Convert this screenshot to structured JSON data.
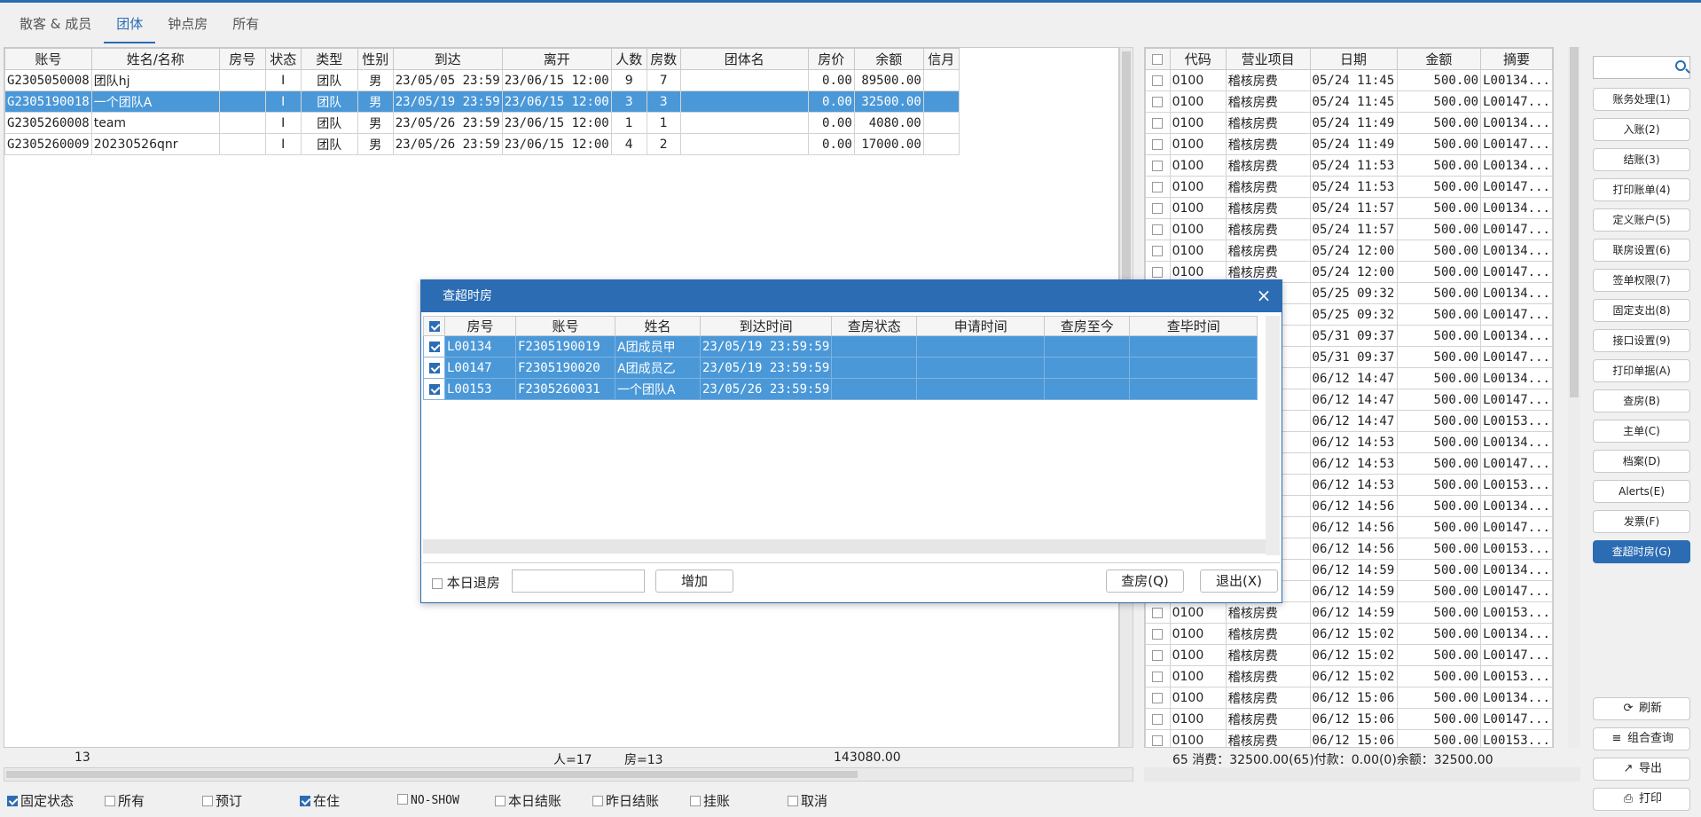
{
  "tabs": [
    "散客 & 成员",
    "团体",
    "钟点房",
    "所有"
  ],
  "left_grid": {
    "columns": [
      "账号",
      "姓名/名称",
      "房号",
      "状态",
      "类型",
      "性别",
      "到达",
      "离开",
      "人数",
      "房数",
      "团体名",
      "房价",
      "余额",
      "信月"
    ],
    "rows": [
      [
        "G2305050008",
        "团队hj",
        "",
        "I",
        "团队",
        "男",
        "23/05/05 23:59",
        "23/06/15 12:00",
        "9",
        "7",
        "",
        "0.00",
        "89500.00",
        ""
      ],
      [
        "G2305190018",
        "一个团队A",
        "",
        "I",
        "团队",
        "男",
        "23/05/19 23:59",
        "23/06/15 12:00",
        "3",
        "3",
        "",
        "0.00",
        "32500.00",
        ""
      ],
      [
        "G2305260008",
        "team",
        "",
        "I",
        "团队",
        "男",
        "23/05/26 23:59",
        "23/06/15 12:00",
        "1",
        "1",
        "",
        "0.00",
        "4080.00",
        ""
      ],
      [
        "G2305260009",
        "20230526qnr",
        "",
        "I",
        "团队",
        "男",
        "23/05/26 23:59",
        "23/06/15 12:00",
        "4",
        "2",
        "",
        "0.00",
        "17000.00",
        ""
      ]
    ],
    "footer": {
      "count": "13",
      "persons": "人=17",
      "rooms": "房=13",
      "total": "143080.00"
    }
  },
  "right_grid": {
    "columns": [
      "代码",
      "营业项目",
      "日期",
      "金额",
      "摘要"
    ],
    "rows": [
      [
        "0100",
        "稽核房费",
        "05/24 11:45",
        "500.00",
        "L00134..."
      ],
      [
        "0100",
        "稽核房费",
        "05/24 11:45",
        "500.00",
        "L00147..."
      ],
      [
        "0100",
        "稽核房费",
        "05/24 11:49",
        "500.00",
        "L00134..."
      ],
      [
        "0100",
        "稽核房费",
        "05/24 11:49",
        "500.00",
        "L00147..."
      ],
      [
        "0100",
        "稽核房费",
        "05/24 11:53",
        "500.00",
        "L00134..."
      ],
      [
        "0100",
        "稽核房费",
        "05/24 11:53",
        "500.00",
        "L00147..."
      ],
      [
        "0100",
        "稽核房费",
        "05/24 11:57",
        "500.00",
        "L00134..."
      ],
      [
        "0100",
        "稽核房费",
        "05/24 11:57",
        "500.00",
        "L00147..."
      ],
      [
        "0100",
        "稽核房费",
        "05/24 12:00",
        "500.00",
        "L00134..."
      ],
      [
        "0100",
        "稽核房费",
        "05/24 12:00",
        "500.00",
        "L00147..."
      ],
      [
        "0100",
        "稽核房费",
        "05/25 09:32",
        "500.00",
        "L00134..."
      ],
      [
        "0100",
        "稽核房费",
        "05/25 09:32",
        "500.00",
        "L00147..."
      ],
      [
        "0100",
        "稽核房费",
        "05/31 09:37",
        "500.00",
        "L00134..."
      ],
      [
        "0100",
        "稽核房费",
        "05/31 09:37",
        "500.00",
        "L00147..."
      ],
      [
        "0100",
        "稽核房费",
        "06/12 14:47",
        "500.00",
        "L00134..."
      ],
      [
        "0100",
        "稽核房费",
        "06/12 14:47",
        "500.00",
        "L00147..."
      ],
      [
        "0100",
        "稽核房费",
        "06/12 14:47",
        "500.00",
        "L00153..."
      ],
      [
        "0100",
        "稽核房费",
        "06/12 14:53",
        "500.00",
        "L00134..."
      ],
      [
        "0100",
        "稽核房费",
        "06/12 14:53",
        "500.00",
        "L00147..."
      ],
      [
        "0100",
        "稽核房费",
        "06/12 14:53",
        "500.00",
        "L00153..."
      ],
      [
        "0100",
        "稽核房费",
        "06/12 14:56",
        "500.00",
        "L00134..."
      ],
      [
        "0100",
        "稽核房费",
        "06/12 14:56",
        "500.00",
        "L00147..."
      ],
      [
        "0100",
        "稽核房费",
        "06/12 14:56",
        "500.00",
        "L00153..."
      ],
      [
        "0100",
        "稽核房费",
        "06/12 14:59",
        "500.00",
        "L00134..."
      ],
      [
        "0100",
        "稽核房费",
        "06/12 14:59",
        "500.00",
        "L00147..."
      ],
      [
        "0100",
        "稽核房费",
        "06/12 14:59",
        "500.00",
        "L00153..."
      ],
      [
        "0100",
        "稽核房费",
        "06/12 15:02",
        "500.00",
        "L00134..."
      ],
      [
        "0100",
        "稽核房费",
        "06/12 15:02",
        "500.00",
        "L00147..."
      ],
      [
        "0100",
        "稽核房费",
        "06/12 15:02",
        "500.00",
        "L00153..."
      ],
      [
        "0100",
        "稽核房费",
        "06/12 15:06",
        "500.00",
        "L00134..."
      ],
      [
        "0100",
        "稽核房费",
        "06/12 15:06",
        "500.00",
        "L00147..."
      ],
      [
        "0100",
        "稽核房费",
        "06/12 15:06",
        "500.00",
        "L00153..."
      ]
    ],
    "footer": "65 消费：32500.00(65)付款：0.00(0)余额：32500.00"
  },
  "sidebar": {
    "buttons": [
      "账务处理(1)",
      "入账(2)",
      "结账(3)",
      "打印账单(4)",
      "定义账户(5)",
      "联房设置(6)",
      "签单权限(7)",
      "固定支出(8)",
      "接口设置(9)",
      "打印单据(A)",
      "查房(B)",
      "主单(C)",
      "档案(D)",
      "Alerts(E)",
      "发票(F)",
      "查超时房(G)"
    ],
    "actions": [
      {
        "icon": "⟳",
        "label": "刷新"
      },
      {
        "icon": "≡",
        "label": "组合查询"
      },
      {
        "icon": "↗",
        "label": "导出"
      },
      {
        "icon": "⎙",
        "label": "打印"
      }
    ]
  },
  "filters": [
    "固定状态",
    "所有",
    "预订",
    "在住",
    "NO-SHOW",
    "本日结账",
    "昨日结账",
    "挂账",
    "取消"
  ],
  "modal": {
    "title": "查超时房",
    "columns": [
      "房号",
      "账号",
      "姓名",
      "到达时间",
      "查房状态",
      "申请时间",
      "查房至今",
      "查毕时间"
    ],
    "rows": [
      [
        "L00134",
        "F2305190019",
        "A团成员甲",
        "23/05/19 23:59:59",
        "",
        "",
        "",
        ""
      ],
      [
        "L00147",
        "F2305190020",
        "A团成员乙",
        "23/05/19 23:59:59",
        "",
        "",
        "",
        ""
      ],
      [
        "L00153",
        "F2305260031",
        "一个团队A",
        "23/05/26 23:59:59",
        "",
        "",
        "",
        ""
      ]
    ],
    "checkout_today_label": "本日退房",
    "add_label": "增加",
    "check_label": "查房(Q)",
    "exit_label": "退出(X)"
  }
}
